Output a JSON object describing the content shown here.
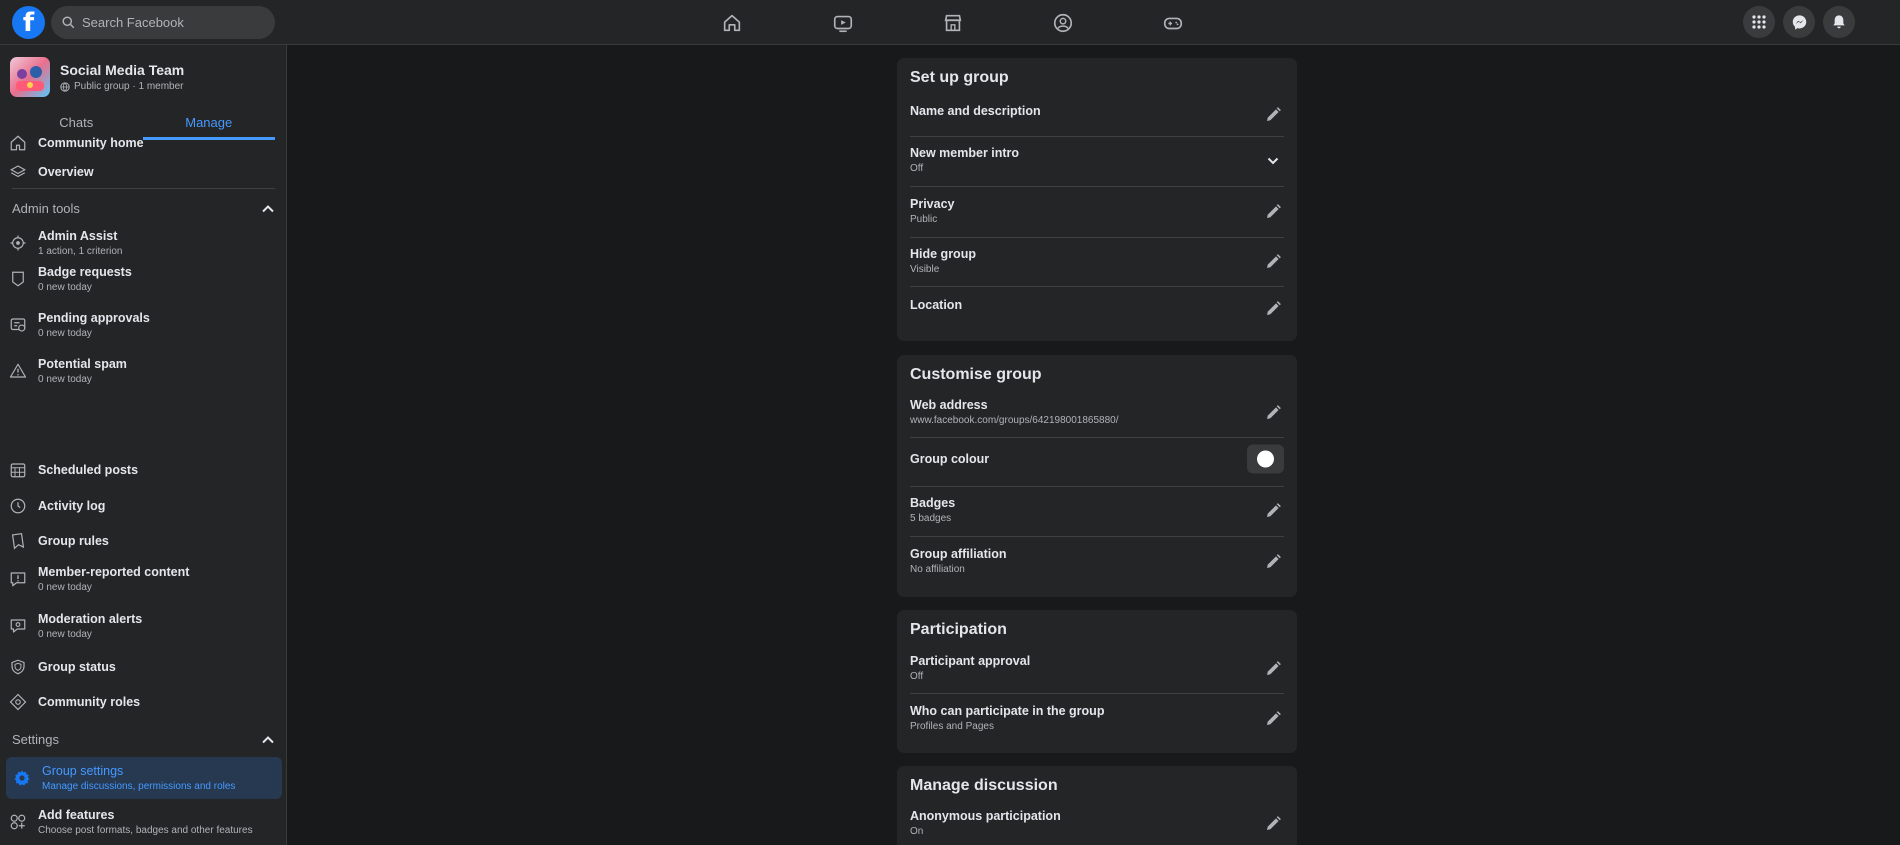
{
  "topbar": {
    "logo_letter": "f",
    "search_placeholder": "Search Facebook",
    "nav_icons": [
      "home-icon",
      "watch-icon",
      "marketplace-icon",
      "groups-icon",
      "gaming-icon"
    ],
    "right_icons": [
      "menu-grid-icon",
      "messenger-icon",
      "notifications-icon"
    ]
  },
  "group": {
    "name": "Social Media Team",
    "meta": "Public group · 1 member"
  },
  "tabs": [
    {
      "label": "Chats"
    },
    {
      "label": "Manage"
    }
  ],
  "sidebar": {
    "top_items": [
      {
        "label": "Community home",
        "icon": "home-outline-icon"
      },
      {
        "label": "Overview",
        "icon": "layers-icon"
      }
    ],
    "admin_tools_title": "Admin tools",
    "admin_items": [
      {
        "label": "Admin Assist",
        "sub": "1 action, 1 criterion",
        "icon": "admin-assist-icon"
      },
      {
        "label": "Badge requests",
        "sub": "0 new today",
        "icon": "badge-icon"
      },
      {
        "label": "Pending approvals",
        "sub": "0 new today",
        "icon": "approvals-icon"
      },
      {
        "label": "Potential spam",
        "sub": "0 new today",
        "icon": "warning-icon"
      },
      {
        "label": "Scheduled posts",
        "sub": "",
        "icon": "calendar-icon"
      },
      {
        "label": "Activity log",
        "sub": "",
        "icon": "clock-icon"
      },
      {
        "label": "Group rules",
        "sub": "",
        "icon": "rules-icon"
      },
      {
        "label": "Member-reported content",
        "sub": "0 new today",
        "icon": "report-icon"
      },
      {
        "label": "Moderation alerts",
        "sub": "0 new today",
        "icon": "alert-icon"
      },
      {
        "label": "Group status",
        "sub": "",
        "icon": "shield-icon"
      },
      {
        "label": "Community roles",
        "sub": "",
        "icon": "diamond-icon"
      }
    ],
    "settings_title": "Settings",
    "settings_items": [
      {
        "label": "Group settings",
        "sub": "Manage discussions, permissions and roles",
        "icon": "gear-icon"
      },
      {
        "label": "Add features",
        "sub": "Choose post formats, badges and other features",
        "icon": "features-icon"
      }
    ]
  },
  "cards": {
    "setup": {
      "title": "Set up group",
      "rows": [
        {
          "label": "Name and description",
          "sub": ""
        },
        {
          "label": "New member intro",
          "sub": "Off"
        },
        {
          "label": "Privacy",
          "sub": "Public"
        },
        {
          "label": "Hide group",
          "sub": "Visible"
        },
        {
          "label": "Location",
          "sub": ""
        }
      ]
    },
    "customise": {
      "title": "Customise group",
      "rows": [
        {
          "label": "Web address",
          "sub": "www.facebook.com/groups/642198001865880/"
        },
        {
          "label": "Group colour",
          "sub": ""
        },
        {
          "label": "Badges",
          "sub": "5 badges"
        },
        {
          "label": "Group affiliation",
          "sub": "No affiliation"
        }
      ]
    },
    "participation": {
      "title": "Participation",
      "rows": [
        {
          "label": "Participant approval",
          "sub": "Off"
        },
        {
          "label": "Who can participate in the group",
          "sub": "Profiles and Pages"
        }
      ]
    },
    "discussion": {
      "title": "Manage discussion",
      "rows": [
        {
          "label": "Anonymous participation",
          "sub": "On"
        }
      ]
    }
  },
  "colors": {
    "accent": "#4599ff",
    "brand": "#1877f2",
    "background": "#18191a",
    "panel": "#242526"
  }
}
